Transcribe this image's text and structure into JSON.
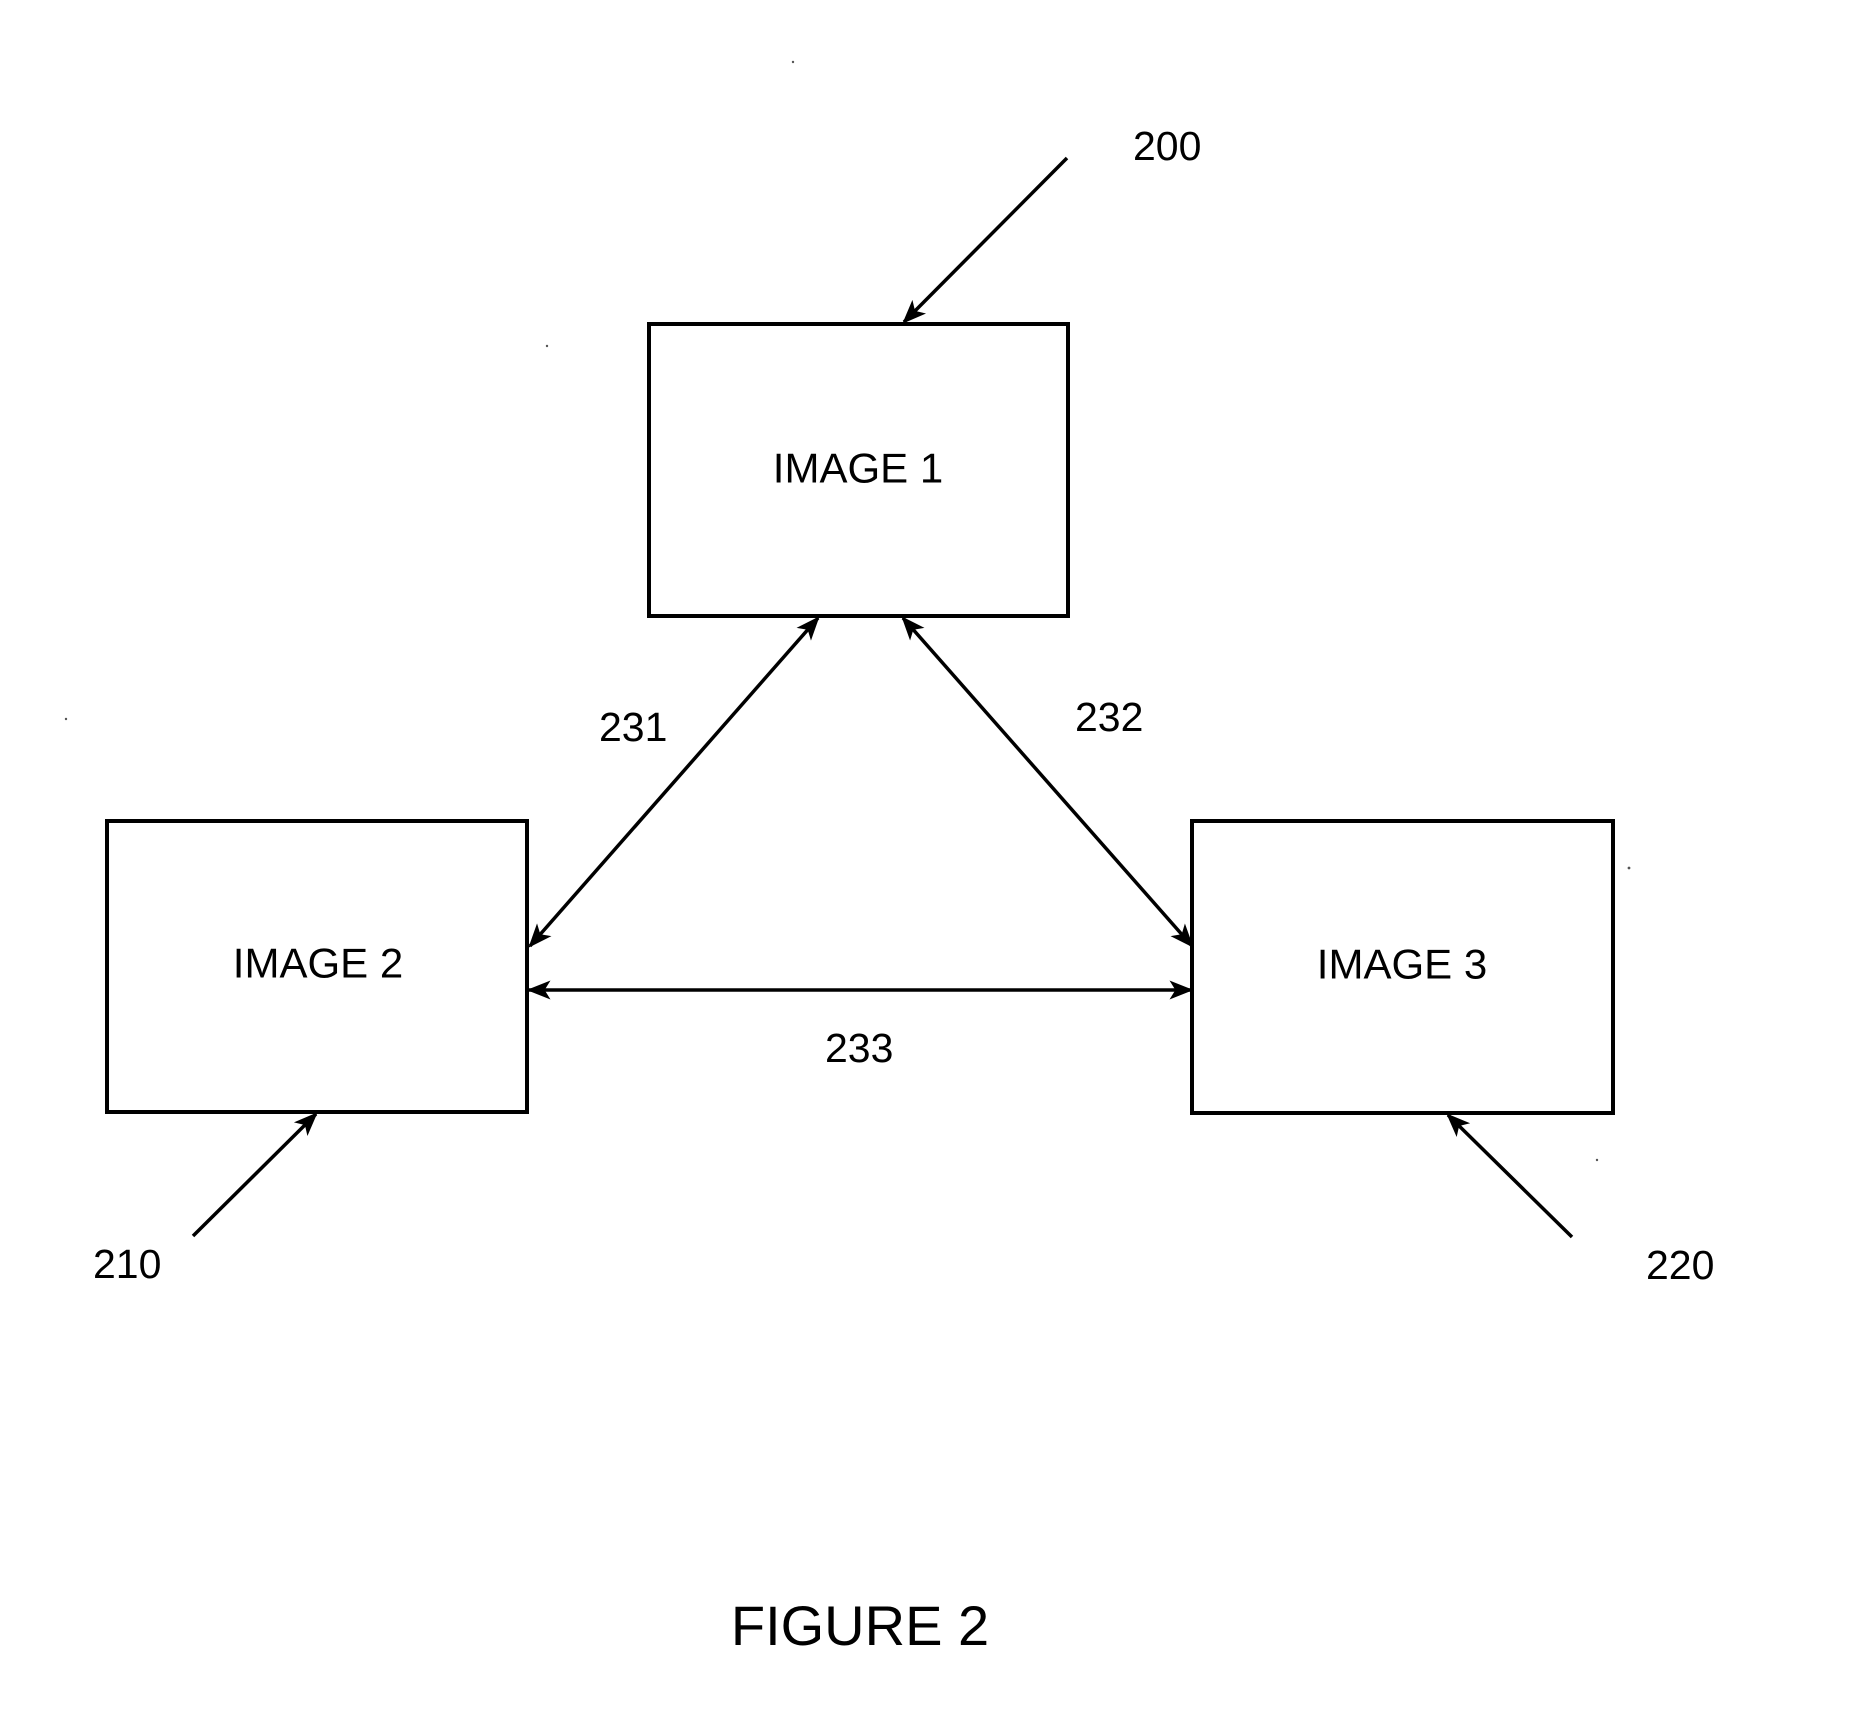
{
  "figure": {
    "caption": "FIGURE 2",
    "colors": {
      "stroke": "#000000",
      "background": "#ffffff"
    },
    "nodes": [
      {
        "id": "image1",
        "label": "IMAGE 1",
        "ref": "200"
      },
      {
        "id": "image2",
        "label": "IMAGE 2",
        "ref": "210"
      },
      {
        "id": "image3",
        "label": "IMAGE 3",
        "ref": "220"
      }
    ],
    "connections": [
      {
        "ref": "231",
        "from": "image1",
        "to": "image2",
        "direction": "bidirectional"
      },
      {
        "ref": "232",
        "from": "image1",
        "to": "image3",
        "direction": "bidirectional"
      },
      {
        "ref": "233",
        "from": "image2",
        "to": "image3",
        "direction": "bidirectional"
      }
    ],
    "reference_labels": {
      "r200": "200",
      "r210": "210",
      "r220": "220",
      "r231": "231",
      "r232": "232",
      "r233": "233"
    }
  }
}
